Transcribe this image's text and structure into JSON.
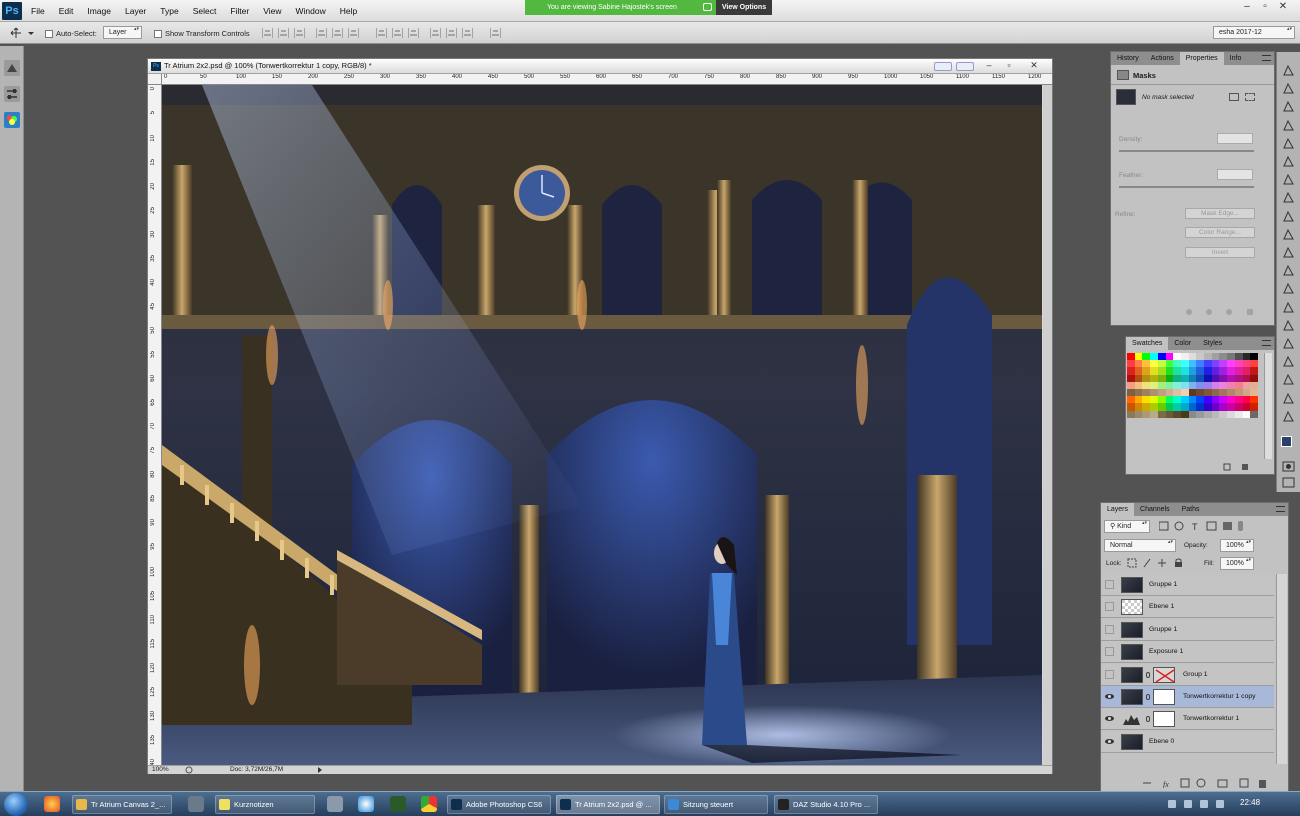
{
  "app": {
    "logo": "Ps"
  },
  "menu": [
    "File",
    "Edit",
    "Image",
    "Layer",
    "Type",
    "Select",
    "Filter",
    "View",
    "Window",
    "Help"
  ],
  "share": {
    "banner_text": "You are viewing Sabine Hajostek's screen",
    "view_options": "View Options"
  },
  "window_controls": {
    "minimize": "–",
    "restore": "▫",
    "close": "✕"
  },
  "options_bar": {
    "auto_select_label": "Auto-Select:",
    "auto_select_value": "Layer",
    "show_transform_label": "Show Transform Controls",
    "workspace": "esha 2017-12"
  },
  "document": {
    "title": "Tr Atrium 2x2.psd @ 100% (Tonwertkorrektur 1 copy, RGB/8) *",
    "zoom": "100%",
    "doc_size": "Doc: 3,72M/26,7M",
    "ruler_h": [
      "0",
      "50",
      "100",
      "150",
      "200",
      "250",
      "300",
      "350",
      "400",
      "450",
      "500",
      "550",
      "600",
      "650",
      "700",
      "750",
      "800",
      "850",
      "900",
      "950",
      "1000",
      "1050",
      "1100",
      "1150",
      "1200"
    ],
    "ruler_v": [
      "0",
      "5",
      "10",
      "15",
      "20",
      "25",
      "30",
      "35",
      "40",
      "45",
      "50",
      "55",
      "60",
      "65",
      "70",
      "75",
      "80",
      "85",
      "90",
      "95",
      "100",
      "105",
      "110",
      "115",
      "120",
      "125",
      "130",
      "135",
      "140"
    ]
  },
  "properties_panel": {
    "tabs": [
      "History",
      "Actions",
      "Properties",
      "Info"
    ],
    "active_tab": "Properties",
    "section": "Masks",
    "mask_status": "No mask selected",
    "density_label": "Density:",
    "feather_label": "Feather:",
    "refine_label": "Refine:",
    "buttons": [
      "Mask Edge...",
      "Color Range...",
      "Invert"
    ]
  },
  "swatches_panel": {
    "tabs": [
      "Swatches",
      "Color",
      "Styles"
    ],
    "active_tab": "Swatches",
    "rows": [
      [
        "#ff0000",
        "#ffff00",
        "#00ff00",
        "#00ffff",
        "#0000ff",
        "#ff00ff",
        "#ffffff",
        "#f0f0f0",
        "#dddddd",
        "#c8c8c8",
        "#b4b4b4",
        "#a0a0a0",
        "#8c8c8c",
        "#787878",
        "#505050",
        "#282828",
        "#000000"
      ],
      [
        "#ff4040",
        "#ff8040",
        "#ffc040",
        "#ffff40",
        "#c0ff40",
        "#40ff40",
        "#40ffc0",
        "#40ffff",
        "#40c0ff",
        "#4080ff",
        "#4040ff",
        "#8040ff",
        "#c040ff",
        "#ff40ff",
        "#ff40c0",
        "#ff4080",
        "#ff4040"
      ],
      [
        "#e02020",
        "#e06020",
        "#e0a020",
        "#e0e020",
        "#a0e020",
        "#20e020",
        "#20e0a0",
        "#20e0e0",
        "#20a0e0",
        "#2060e0",
        "#2020e0",
        "#6020e0",
        "#a020e0",
        "#e020e0",
        "#e020a0",
        "#e02060",
        "#c01818"
      ],
      [
        "#b01010",
        "#b05010",
        "#b09010",
        "#b0b010",
        "#80b010",
        "#10b010",
        "#10b080",
        "#10b0b0",
        "#1080b0",
        "#1050b0",
        "#1010b0",
        "#5010b0",
        "#8010b0",
        "#b010b0",
        "#b01080",
        "#b01050",
        "#901010"
      ],
      [
        "#f0a080",
        "#f0c080",
        "#f0e080",
        "#e0f080",
        "#a0f080",
        "#80f0a0",
        "#80f0e0",
        "#80e0f0",
        "#80b0f0",
        "#8090f0",
        "#a080f0",
        "#d080f0",
        "#f080e0",
        "#f080b0",
        "#f08090",
        "#f0a0a0",
        "#e0b090"
      ],
      [
        "#806040",
        "#907050",
        "#a08060",
        "#b09070",
        "#c0a080",
        "#d0b090",
        "#e0c0a0",
        "#f0d0b0",
        "#603820",
        "#704830",
        "#805838",
        "#906848",
        "#a07858",
        "#b08868",
        "#c09878",
        "#d0a888",
        "#e0b898"
      ],
      [
        "#ff6600",
        "#ffaa00",
        "#ffdd00",
        "#ddff00",
        "#88ff00",
        "#00ff66",
        "#00ffcc",
        "#00ccff",
        "#0088ff",
        "#0044ff",
        "#4400ff",
        "#8800ff",
        "#cc00ff",
        "#ff00cc",
        "#ff0088",
        "#ff0044",
        "#ff3300"
      ],
      [
        "#cc5500",
        "#cc8800",
        "#ccaa00",
        "#aacc00",
        "#66cc00",
        "#00cc55",
        "#00ccaa",
        "#00aacc",
        "#0066cc",
        "#0033cc",
        "#3300cc",
        "#6600cc",
        "#aa00cc",
        "#cc00aa",
        "#cc0066",
        "#cc0033",
        "#cc2200"
      ],
      [
        "#8a7a5a",
        "#9a8a6a",
        "#aa9a7a",
        "#baa a8a",
        "#7a6a4a",
        "#6a5a3a",
        "#5a4a2a",
        "#4a3a1a",
        "#8a8a8a",
        "#9a9a9a",
        "#aaaaaa",
        "#bababa",
        "#cacaca",
        "#dadada",
        "#eaeaea",
        "#fafafa",
        "#6a6a6a"
      ]
    ]
  },
  "layers_panel": {
    "tabs": [
      "Layers",
      "Channels",
      "Paths"
    ],
    "active_tab": "Layers",
    "filter": "Kind",
    "blend_mode": "Normal",
    "opacity_label": "Opacity:",
    "opacity": "100%",
    "lock_label": "Lock:",
    "fill_label": "Fill:",
    "fill": "100%",
    "layers": [
      {
        "name": "Gruppe 1",
        "visible": false,
        "thumb": "dark",
        "mask": false,
        "selected": false
      },
      {
        "name": "Ebene 1",
        "visible": false,
        "thumb": "transparent",
        "mask": false,
        "selected": false
      },
      {
        "name": "Gruppe 1",
        "visible": false,
        "thumb": "dark",
        "mask": false,
        "selected": false
      },
      {
        "name": "Exposure 1",
        "visible": false,
        "thumb": "dark",
        "mask": false,
        "selected": false
      },
      {
        "name": "Group 1",
        "visible": false,
        "thumb": "dark",
        "mask": "red-x",
        "selected": false
      },
      {
        "name": "Tonwertkorrektur 1 copy",
        "visible": true,
        "thumb": "dark",
        "mask": "white",
        "selected": true
      },
      {
        "name": "Tonwertkorrektur 1",
        "visible": true,
        "thumb": "levels",
        "mask": "white",
        "selected": false
      },
      {
        "name": "Ebene 0",
        "visible": true,
        "thumb": "dark",
        "mask": false,
        "selected": false
      }
    ]
  },
  "taskbar": {
    "items": [
      {
        "label": "Tr Atrium Canvas 2_...",
        "icon_color": "#e8b84a",
        "active": false
      },
      {
        "label": "Kurznotizen",
        "icon_color": "#f0e060",
        "active": false
      },
      {
        "label": "Adobe Photoshop CS6",
        "icon_color": "#0e2e4e",
        "active": false
      },
      {
        "label": "Tr Atrium 2x2.psd @ ...",
        "icon_color": "#0e2e4e",
        "active": true
      },
      {
        "label": "Sitzung steuert",
        "icon_color": "#3a8ad8",
        "active": false
      },
      {
        "label": "DAZ Studio 4.10 Pro ...",
        "icon_color": "#222222",
        "active": false
      }
    ],
    "clock": "22:48"
  }
}
